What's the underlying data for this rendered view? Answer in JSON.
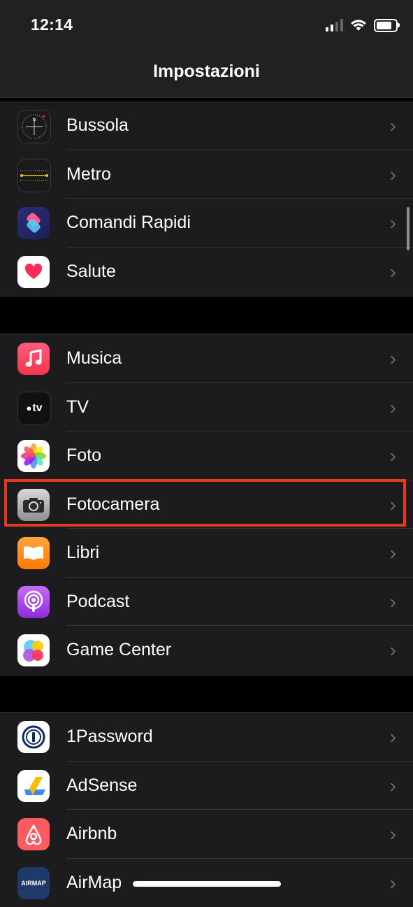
{
  "status_bar": {
    "time": "12:14"
  },
  "nav": {
    "title": "Impostazioni"
  },
  "groups": [
    {
      "rows": [
        {
          "label": "Bussola",
          "icon": "compass-icon"
        },
        {
          "label": "Metro",
          "icon": "ruler-icon"
        },
        {
          "label": "Comandi Rapidi",
          "icon": "shortcuts-icon"
        },
        {
          "label": "Salute",
          "icon": "health-heart-icon"
        }
      ]
    },
    {
      "rows": [
        {
          "label": "Musica",
          "icon": "music-note-icon"
        },
        {
          "label": "TV",
          "icon": "apple-tv-icon",
          "icon_text": "tv"
        },
        {
          "label": "Foto",
          "icon": "photos-flower-icon"
        },
        {
          "label": "Fotocamera",
          "icon": "camera-icon",
          "highlighted": true
        },
        {
          "label": "Libri",
          "icon": "book-icon"
        },
        {
          "label": "Podcast",
          "icon": "podcast-icon"
        },
        {
          "label": "Game Center",
          "icon": "game-center-icon"
        }
      ]
    },
    {
      "rows": [
        {
          "label": "1Password",
          "icon": "1password-icon"
        },
        {
          "label": "AdSense",
          "icon": "adsense-icon"
        },
        {
          "label": "Airbnb",
          "icon": "airbnb-icon"
        },
        {
          "label": "AirMap",
          "icon": "airmap-icon",
          "icon_text": "AIRMAP"
        }
      ]
    }
  ],
  "colors": {
    "highlight": "#e8391e",
    "row_bg": "#1c1c1e",
    "chevron": "#6b6b6f"
  },
  "chevron_glyph": "›"
}
